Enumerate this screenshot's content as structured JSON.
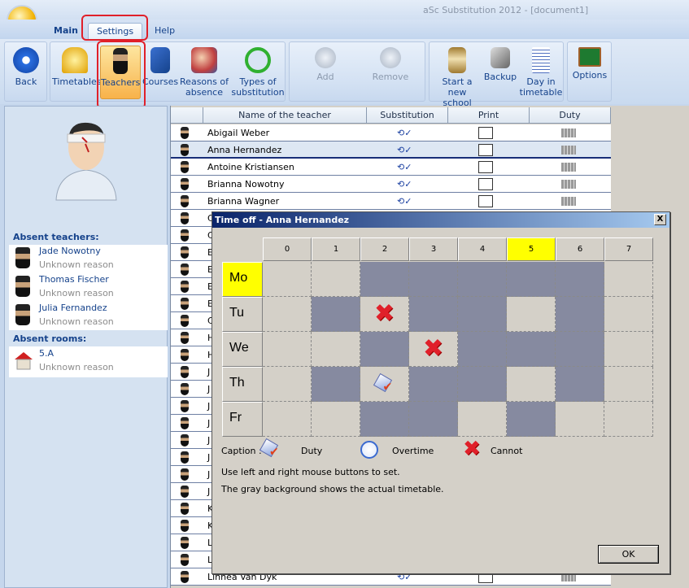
{
  "app": {
    "title": "aSc Substitution 2012  - [document1]"
  },
  "tabs": [
    {
      "label": "Main"
    },
    {
      "label": "Settings"
    },
    {
      "label": "Help"
    }
  ],
  "ribbon": {
    "back": "Back",
    "timetables": "Timetables",
    "teachers": "Teachers",
    "courses": "Courses",
    "reasons": [
      "Reasons of",
      "absence"
    ],
    "types": [
      "Types of",
      "substitution"
    ],
    "add": "Add",
    "remove": "Remove",
    "new_year": [
      "Start a new",
      "school year"
    ],
    "backup": "Backup",
    "day": [
      "Day in",
      "timetable"
    ],
    "options": "Options"
  },
  "left_panel": {
    "absent_teachers_title": "Absent teachers:",
    "absent_teachers": [
      {
        "name": "Jade Nowotny",
        "reason": "Unknown reason"
      },
      {
        "name": "Thomas Fischer",
        "reason": "Unknown reason"
      },
      {
        "name": "Julia Fernandez",
        "reason": "Unknown reason"
      }
    ],
    "absent_rooms_title": "Absent rooms:",
    "absent_rooms": [
      {
        "name": "5.A",
        "reason": "Unknown reason"
      }
    ]
  },
  "table": {
    "columns": [
      "Name of the teacher",
      "Substitution",
      "Print",
      "Duty"
    ],
    "rows": [
      "Abigail Weber",
      "Anna Hernandez",
      "Antoine Kristiansen",
      "Brianna Nowotny",
      "Brianna Wagner",
      "C",
      "C",
      "E",
      "E",
      "E",
      "E",
      "C",
      "H",
      "H",
      "J",
      "J",
      "J",
      "J",
      "J",
      "J",
      "J",
      "J",
      "K",
      "K",
      "L",
      "L",
      "Linnea Van Dyk"
    ],
    "selected": "Anna Hernandez"
  },
  "dialog": {
    "title": "Time off - Anna Hernandez",
    "close": "X",
    "periods": [
      "0",
      "1",
      "2",
      "3",
      "4",
      "5",
      "6",
      "7"
    ],
    "highlight_period": "5",
    "highlight_day": "Mo",
    "days": [
      {
        "label": "Mo",
        "timetable": [
          0,
          0,
          1,
          1,
          1,
          1,
          1,
          0
        ],
        "marks": [
          "",
          "",
          "",
          "",
          "",
          "",
          "",
          ""
        ]
      },
      {
        "label": "Tu",
        "timetable": [
          0,
          1,
          0,
          1,
          1,
          0,
          1,
          0
        ],
        "marks": [
          "",
          "",
          "cannot",
          "",
          "",
          "",
          "",
          ""
        ]
      },
      {
        "label": "We",
        "timetable": [
          0,
          0,
          1,
          0,
          1,
          1,
          1,
          0
        ],
        "marks": [
          "",
          "",
          "",
          "cannot",
          "",
          "",
          "",
          ""
        ]
      },
      {
        "label": "Th",
        "timetable": [
          0,
          1,
          0,
          1,
          1,
          0,
          1,
          0
        ],
        "marks": [
          "",
          "",
          "duty",
          "",
          "",
          "",
          "",
          ""
        ]
      },
      {
        "label": "Fr",
        "timetable": [
          0,
          0,
          1,
          1,
          0,
          1,
          0,
          0
        ],
        "marks": [
          "",
          "",
          "",
          "",
          "",
          "",
          "",
          ""
        ]
      }
    ],
    "caption_label": "Caption :",
    "legend": {
      "duty": "Duty",
      "overtime": "Overtime",
      "cannot": "Cannot"
    },
    "note1": "Use left and right mouse buttons to set.",
    "note2": "The gray background shows the actual timetable.",
    "ok": "OK"
  },
  "colors": {
    "timetable_gray": "#868aa0",
    "highlight": "#ffff00",
    "title_blue": "#0a246a",
    "annotation_red": "#e0202a"
  }
}
